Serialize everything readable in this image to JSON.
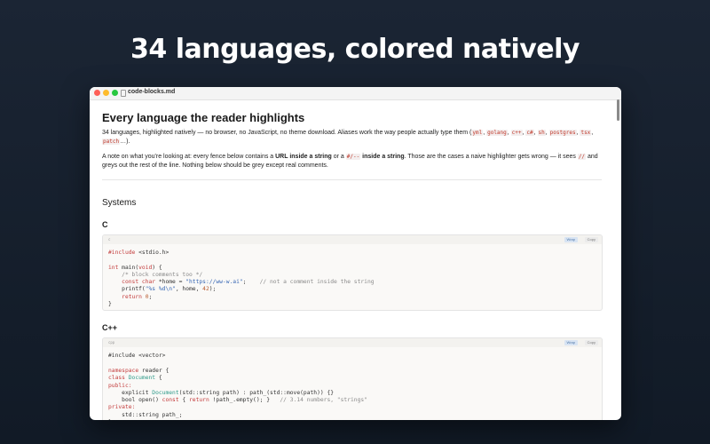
{
  "hero": {
    "title": "34 languages, colored natively"
  },
  "window": {
    "title": "code-blocks.md"
  },
  "doc": {
    "title": "Every language the reader highlights",
    "intro_pre": "34 languages, highlighted natively — no browser, no JavaScript, no theme download. Aliases work the way people actually type them (",
    "aliases": [
      "yml",
      "golang",
      "c++",
      "c#",
      "sh",
      "postgres",
      "tsx",
      "patch"
    ],
    "intro_post": "…).",
    "note_1": "A note on what you're looking at: every fence below contains a ",
    "note_bold_1": "URL inside a string",
    "note_2": " or a ",
    "note_code": "#/--",
    "note_bold_2": " inside a string",
    "note_3": ". Those are the cases a naive highlighter gets wrong — it sees ",
    "note_code_2": "//",
    "note_4": " and greys out the rest of the line. Nothing below should be grey except real comments.",
    "section": "Systems"
  },
  "blocks": [
    {
      "heading": "C",
      "lang": "c",
      "wrap_label": "Wrap",
      "copy_label": "Copy",
      "lines": {
        "l1_k": "#include",
        "l1_r": " <stdio.h>",
        "l3_k": "int",
        "l3_r": " main(",
        "l3_k2": "void",
        "l3_r2": ") {",
        "l4_c": "    /* block comments too */",
        "l5_k": "    const char",
        "l5_r": " *home = ",
        "l5_s": "\"https://ww-w.ai\"",
        "l5_r2": ";    ",
        "l5_c": "// not a comment inside the string",
        "l6_r": "    printf(",
        "l6_s": "\"%s %d\\n\"",
        "l6_r2": ", home, ",
        "l6_n": "42",
        "l6_r3": ");",
        "l7_k": "    return",
        "l7_n": " 0",
        "l7_r": ";",
        "l8_r": "}"
      }
    },
    {
      "heading": "C++",
      "lang": "cpp",
      "wrap_label": "Wrap",
      "copy_label": "Copy",
      "lines": {
        "l1": "#include <vector>",
        "l3_k": "namespace",
        "l3_r": " reader {",
        "l4_k": "class",
        "l4_t": " Document",
        "l4_r": " {",
        "l5_k": "public:",
        "l6_r": "    explicit ",
        "l6_t": "Document",
        "l6_r2": "(std::string path) : path_(std::move(path)) {}",
        "l7_r": "    bool open() ",
        "l7_k": "const",
        "l7_r2": " { ",
        "l7_k2": "return",
        "l7_r3": " !path_.empty(); }   ",
        "l7_c": "// 3.14 numbers, \"strings\"",
        "l8_k": "private:",
        "l9_r": "    std::string path_;",
        "l10_r": "};"
      }
    }
  ]
}
